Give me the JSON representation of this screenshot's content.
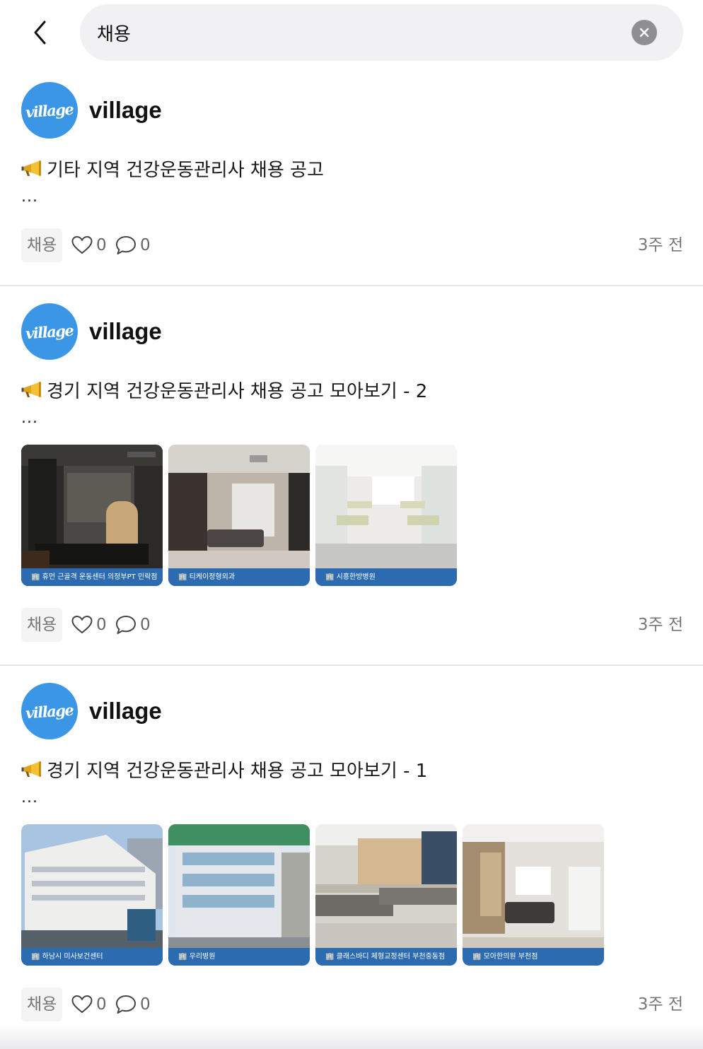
{
  "search": {
    "query": "채용",
    "back_icon": "chevron-left-icon",
    "clear_icon": "close-circle-icon"
  },
  "brand_color": "#3b97e6",
  "posts": [
    {
      "avatar_text": "village",
      "author": "village",
      "title": "기타 지역 건강운동관리사 채용 공고",
      "ellipsis": "...",
      "tag": "채용",
      "likes": "0",
      "comments": "0",
      "time": "3주 전",
      "images": []
    },
    {
      "avatar_text": "village",
      "author": "village",
      "title": "경기 지역 건강운동관리사 채용 공고 모아보기 - 2",
      "ellipsis": "...",
      "tag": "채용",
      "likes": "0",
      "comments": "0",
      "time": "3주 전",
      "images": [
        {
          "caption": "🏢 휴먼 근골격 운동센터 의정부PT 민락점"
        },
        {
          "caption": "🏢 티케이정형외과"
        },
        {
          "caption": "🏢 시흥한방병원"
        }
      ]
    },
    {
      "avatar_text": "village",
      "author": "village",
      "title": "경기 지역 건강운동관리사 채용 공고 모아보기 - 1",
      "ellipsis": "...",
      "tag": "채용",
      "likes": "0",
      "comments": "0",
      "time": "3주 전",
      "images": [
        {
          "caption": "🏢 하남시 미사보건센터"
        },
        {
          "caption": "🏢 우리병원"
        },
        {
          "caption": "🏢 클래스바디 체형교정센터 부천중동점"
        },
        {
          "caption": "🏢 모아한의원 부천점"
        }
      ]
    }
  ]
}
